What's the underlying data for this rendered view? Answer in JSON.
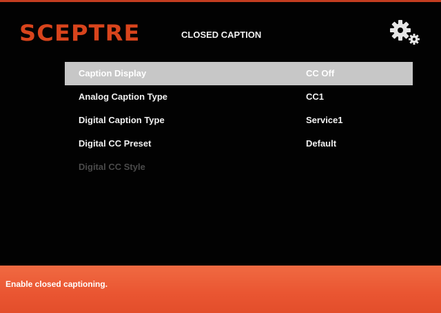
{
  "header": {
    "brand": "SCEPTRE",
    "title": "CLOSED CAPTION",
    "settings_icon": "gear-icon"
  },
  "menu": {
    "items": [
      {
        "label": "Caption Display",
        "value": "CC Off",
        "state": "selected"
      },
      {
        "label": "Analog Caption Type",
        "value": "CC1",
        "state": "normal"
      },
      {
        "label": "Digital Caption Type",
        "value": "Service1",
        "state": "normal"
      },
      {
        "label": "Digital CC Preset",
        "value": "Default",
        "state": "normal"
      },
      {
        "label": "Digital CC Style",
        "value": "",
        "state": "disabled"
      }
    ]
  },
  "footer": {
    "help_text": "Enable closed captioning."
  },
  "colors": {
    "brand": "#d8441c",
    "frame_top": "#c23d20",
    "footer": "#ea5632",
    "selected_row": "#c7c7c7",
    "disabled_text": "#4a4a4a"
  }
}
